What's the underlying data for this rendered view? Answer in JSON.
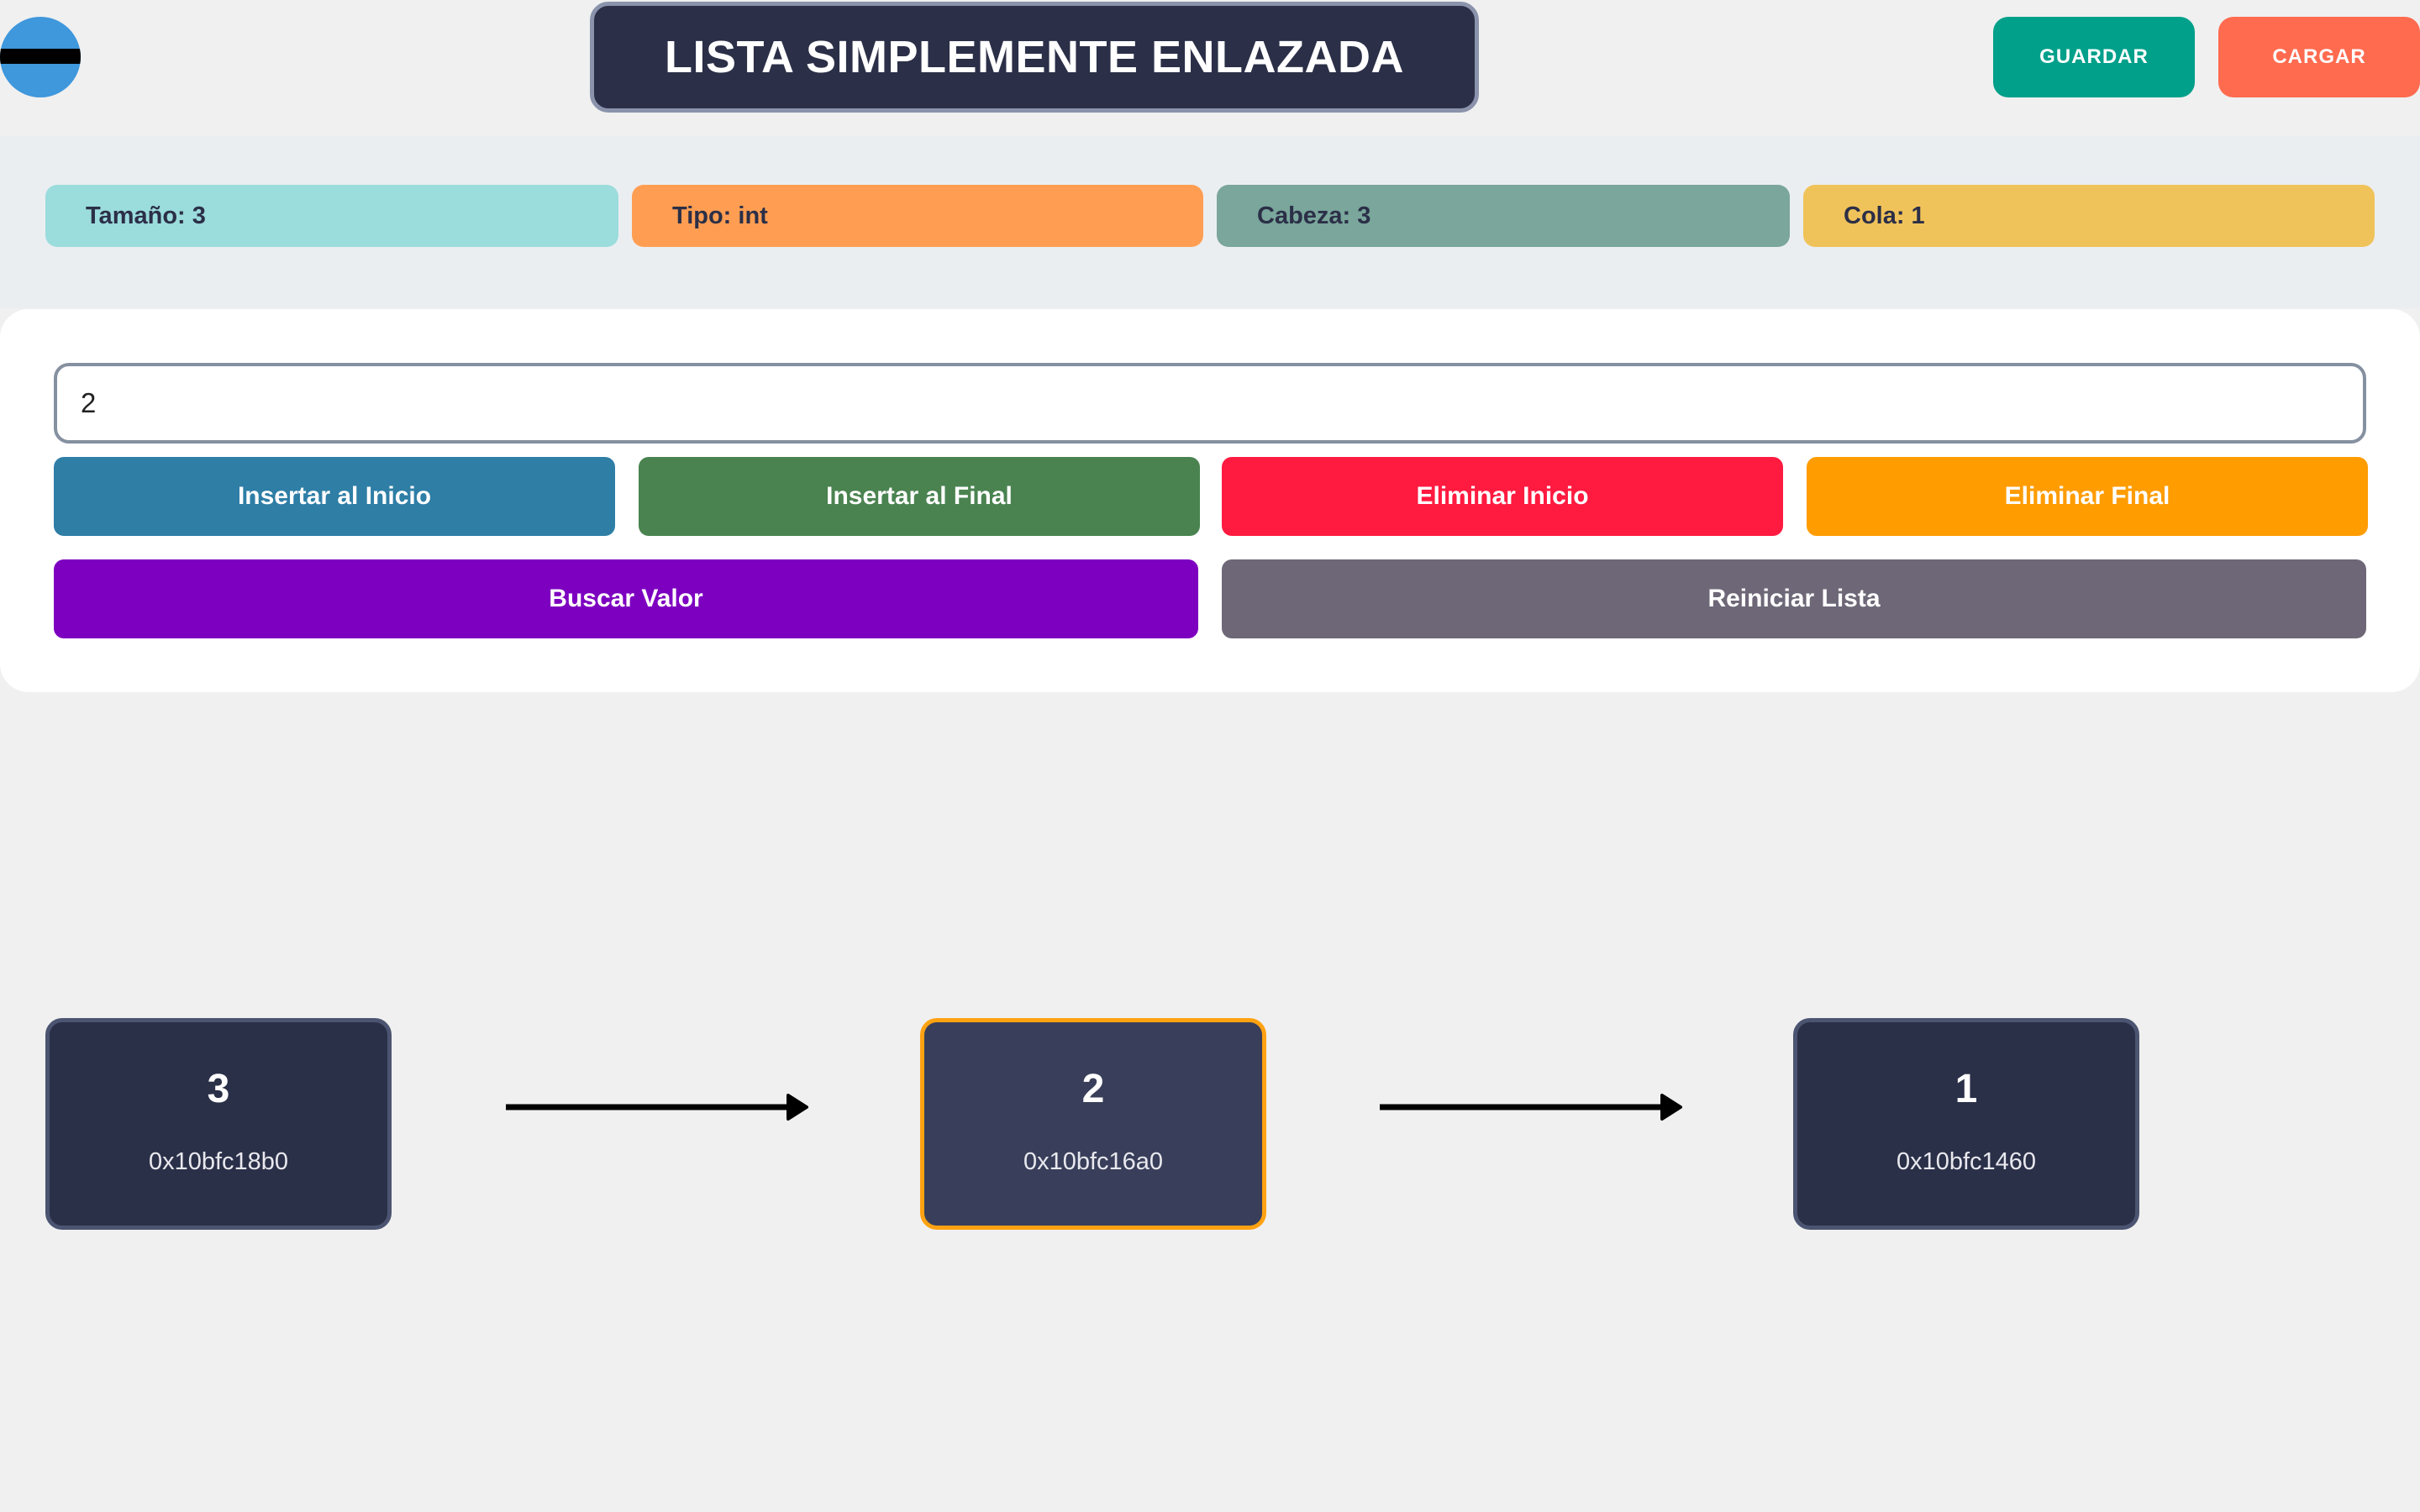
{
  "header": {
    "title": "LISTA SIMPLEMENTE ENLAZADA",
    "save_label": "GUARDAR",
    "load_label": "CARGAR"
  },
  "stats": {
    "size": "Tamaño: 3",
    "type": "Tipo: int",
    "head": "Cabeza: 3",
    "tail": "Cola: 1"
  },
  "controls": {
    "input_value": "2",
    "insert_start": "Insertar al Inicio",
    "insert_end": "Insertar al Final",
    "delete_start": "Eliminar Inicio",
    "delete_end": "Eliminar Final",
    "search": "Buscar Valor",
    "reset": "Reiniciar Lista"
  },
  "nodes": [
    {
      "value": "3",
      "address": "0x10bfc18b0",
      "highlighted": false
    },
    {
      "value": "2",
      "address": "0x10bfc16a0",
      "highlighted": true
    },
    {
      "value": "1",
      "address": "0x10bfc1460",
      "highlighted": false
    }
  ],
  "colors": {
    "title_bg": "#2b2f47",
    "save": "#00a08a",
    "load": "#ff6b4f",
    "node_bg": "#2b3049",
    "node_highlight_border": "#ffa212"
  },
  "icons": {
    "logo": "circle-logo-icon",
    "arrow": "right-arrow-icon"
  }
}
